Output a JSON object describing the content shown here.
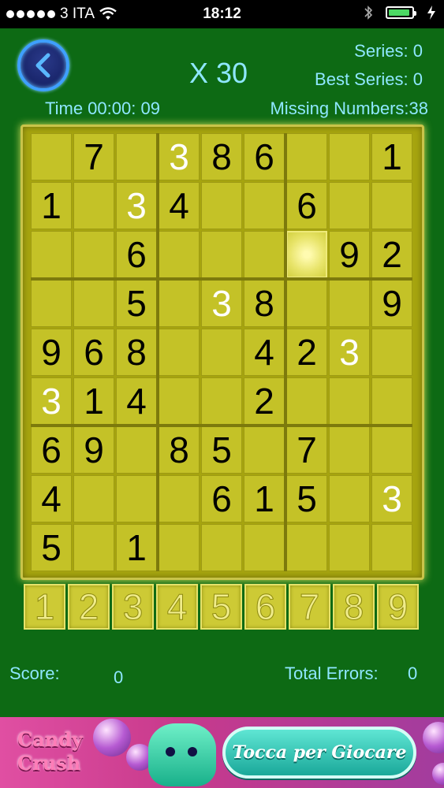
{
  "status_bar": {
    "carrier": "3 ITA",
    "time": "18:12"
  },
  "header": {
    "multiplier": "X 30",
    "series": "Series: 0",
    "best_series": "Best Series: 0",
    "time": "Time  00:00: 09",
    "missing_numbers": "Missing Numbers:38"
  },
  "board": {
    "rows": [
      [
        "",
        "7",
        "",
        "3",
        "8",
        "6",
        "",
        "",
        "1"
      ],
      [
        "1",
        "",
        "3",
        "4",
        "",
        "",
        "6",
        "",
        ""
      ],
      [
        "",
        "",
        "6",
        "",
        "",
        "",
        "",
        "9",
        "2"
      ],
      [
        "",
        "",
        "5",
        "",
        "3",
        "8",
        "",
        "",
        "9"
      ],
      [
        "9",
        "6",
        "8",
        "",
        "",
        "4",
        "2",
        "3",
        ""
      ],
      [
        "3",
        "1",
        "4",
        "",
        "",
        "2",
        "",
        "",
        ""
      ],
      [
        "6",
        "9",
        "",
        "8",
        "5",
        "",
        "7",
        "",
        ""
      ],
      [
        "4",
        "",
        "",
        "",
        "6",
        "1",
        "5",
        "",
        "3"
      ],
      [
        "5",
        "",
        "1",
        "",
        "",
        "",
        "",
        "",
        ""
      ]
    ],
    "white_cells": [
      [
        0,
        3
      ],
      [
        1,
        2
      ],
      [
        3,
        4
      ],
      [
        4,
        7
      ],
      [
        5,
        0
      ],
      [
        7,
        8
      ]
    ],
    "selected_cell": [
      2,
      6
    ]
  },
  "number_pad": [
    "1",
    "2",
    "3",
    "4",
    "5",
    "6",
    "7",
    "8",
    "9"
  ],
  "footer": {
    "score_label": "Score:",
    "score_value": "0",
    "errors_label": "Total Errors:",
    "errors_value": "0"
  },
  "ad_banner": {
    "logo_text": "Candy Crush",
    "play_label": "Tocca per Giocare"
  },
  "colors": {
    "background": "#0d6a14",
    "hud_text": "#8fe7ff",
    "cell": "#c4c227"
  }
}
